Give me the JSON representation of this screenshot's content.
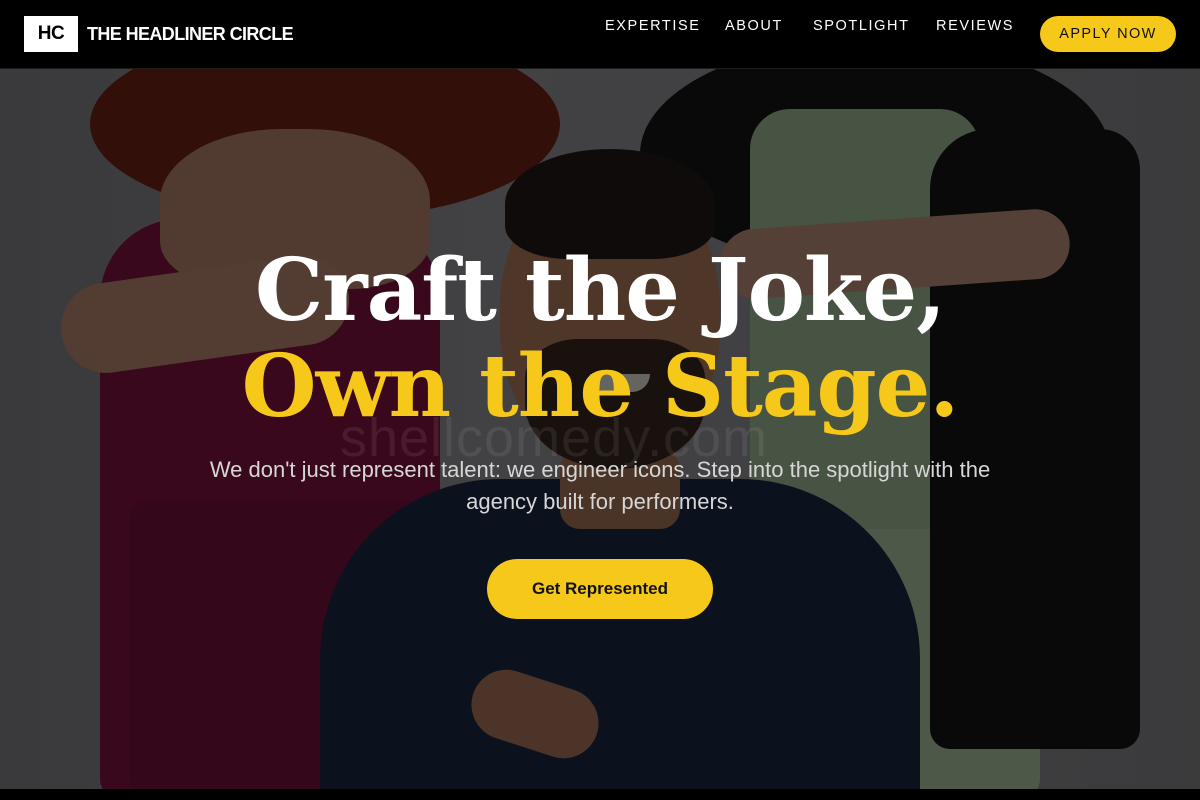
{
  "header": {
    "logo_initials": "HC",
    "brand_name": "THE HEADLINER CIRCLE",
    "nav": [
      "EXPERTISE",
      "ABOUT",
      "SPOTLIGHT",
      "REVIEWS"
    ],
    "apply_label": "APPLY NOW"
  },
  "hero": {
    "headline_line1": "Craft the Joke,",
    "headline_line2": "Own the Stage.",
    "subtitle": "We don't just represent talent: we engineer icons. Step into the spotlight with the agency built for performers.",
    "cta_label": "Get Represented",
    "watermark": "shellcomedy.com"
  },
  "colors": {
    "accent": "#f6c81a",
    "header_bg": "#000000",
    "text_primary": "#ffffff"
  }
}
